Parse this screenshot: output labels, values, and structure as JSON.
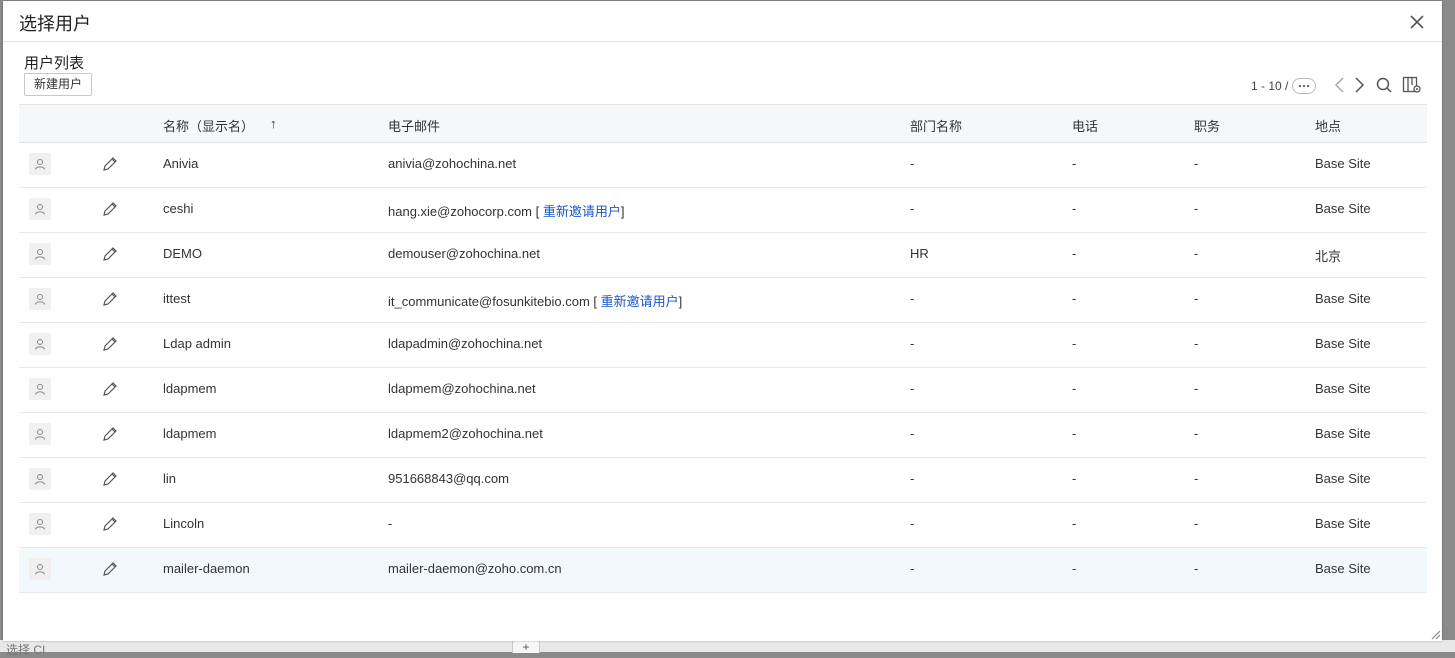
{
  "backdrop": {
    "left_text": "选择 CI",
    "plus": "+"
  },
  "dialog": {
    "title": "选择用户"
  },
  "list": {
    "title": "用户列表",
    "new_button": "新建用户",
    "pager": {
      "range": "1 - 10 /"
    }
  },
  "table": {
    "headers": {
      "name": "名称（显示名）",
      "email": "电子邮件",
      "dept": "部门名称",
      "phone": "电话",
      "title": "职务",
      "site": "地点"
    },
    "sort_indicator": "↑",
    "invite_label": "重新邀请用户",
    "rows": [
      {
        "name": "Anivia",
        "email": "anivia@zohochina.net",
        "invite": false,
        "dept": "-",
        "phone": "-",
        "title": "-",
        "site": "Base Site"
      },
      {
        "name": "ceshi",
        "email": "hang.xie@zohocorp.com",
        "invite": true,
        "dept": "-",
        "phone": "-",
        "title": "-",
        "site": "Base Site"
      },
      {
        "name": "DEMO",
        "email": "demouser@zohochina.net",
        "invite": false,
        "dept": "HR",
        "phone": "-",
        "title": "-",
        "site": "北京"
      },
      {
        "name": "ittest",
        "email": "it_communicate@fosunkitebio.com",
        "invite": true,
        "dept": "-",
        "phone": "-",
        "title": "-",
        "site": "Base Site"
      },
      {
        "name": "Ldap admin",
        "email": "ldapadmin@zohochina.net",
        "invite": false,
        "dept": "-",
        "phone": "-",
        "title": "-",
        "site": "Base Site"
      },
      {
        "name": "ldapmem",
        "email": "ldapmem@zohochina.net",
        "invite": false,
        "dept": "-",
        "phone": "-",
        "title": "-",
        "site": "Base Site"
      },
      {
        "name": "ldapmem",
        "email": "ldapmem2@zohochina.net",
        "invite": false,
        "dept": "-",
        "phone": "-",
        "title": "-",
        "site": "Base Site"
      },
      {
        "name": "lin",
        "email": "951668843@qq.com",
        "invite": false,
        "dept": "-",
        "phone": "-",
        "title": "-",
        "site": "Base Site"
      },
      {
        "name": "Lincoln",
        "email": "-",
        "invite": false,
        "dept": "-",
        "phone": "-",
        "title": "-",
        "site": "Base Site"
      },
      {
        "name": "mailer-daemon",
        "email": "mailer-daemon@zoho.com.cn",
        "invite": false,
        "dept": "-",
        "phone": "-",
        "title": "-",
        "site": "Base Site",
        "highlighted": true
      }
    ]
  },
  "icons": {
    "close": "close-icon",
    "more": "ellipsis-icon",
    "prev": "chevron-left-icon",
    "next": "chevron-right-icon",
    "search": "search-icon",
    "columns": "column-settings-icon",
    "avatar": "user-icon",
    "edit": "pencil-icon",
    "resize": "resize-handle-icon"
  },
  "colors": {
    "link": "#1a57c8",
    "row_highlight": "#f2f9fd",
    "header_bg": "#f6f7f9"
  }
}
